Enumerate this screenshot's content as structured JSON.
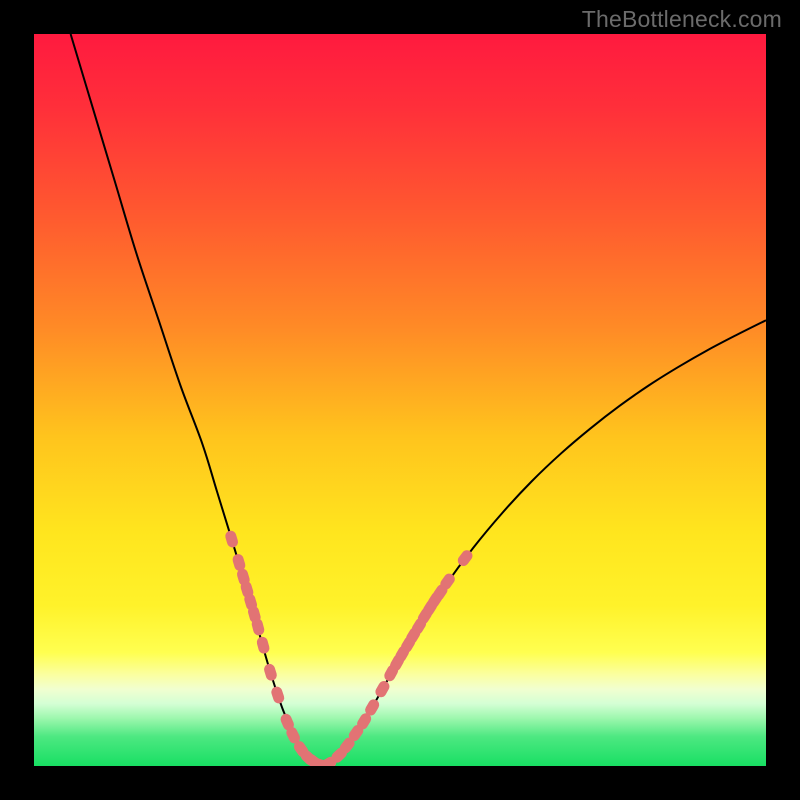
{
  "watermark": "TheBottleneck.com",
  "colors": {
    "frame": "#000000",
    "curve": "#000000",
    "marker": "#e27374",
    "gradient_stops": [
      {
        "offset": 0.0,
        "color": "#ff1a3f"
      },
      {
        "offset": 0.1,
        "color": "#ff2f3a"
      },
      {
        "offset": 0.25,
        "color": "#ff5a2f"
      },
      {
        "offset": 0.4,
        "color": "#ff8a26"
      },
      {
        "offset": 0.55,
        "color": "#ffc41d"
      },
      {
        "offset": 0.68,
        "color": "#ffe51e"
      },
      {
        "offset": 0.78,
        "color": "#fff22a"
      },
      {
        "offset": 0.845,
        "color": "#ffff50"
      },
      {
        "offset": 0.875,
        "color": "#fbffa0"
      },
      {
        "offset": 0.895,
        "color": "#f1ffd0"
      },
      {
        "offset": 0.915,
        "color": "#d4ffd4"
      },
      {
        "offset": 0.935,
        "color": "#9cf7ad"
      },
      {
        "offset": 0.96,
        "color": "#4de881"
      },
      {
        "offset": 1.0,
        "color": "#18df63"
      }
    ]
  },
  "chart_data": {
    "type": "line",
    "title": "",
    "xlabel": "",
    "ylabel": "",
    "xlim": [
      0,
      100
    ],
    "ylim": [
      0,
      100
    ],
    "grid": false,
    "legend": false,
    "series": [
      {
        "name": "bottleneck-curve",
        "x": [
          5,
          8,
          11,
          14,
          17,
          20,
          23,
          25,
          27,
          28.5,
          30,
          31,
          32,
          33,
          34,
          35,
          36,
          37,
          38,
          39,
          40,
          42,
          44,
          46,
          48,
          50,
          53,
          56,
          60,
          64,
          68,
          72,
          76,
          80,
          84,
          88,
          92,
          96,
          100
        ],
        "y": [
          100,
          90,
          80,
          70,
          61,
          52,
          44,
          37.5,
          31,
          26,
          21,
          17.3,
          13.8,
          10.6,
          7.7,
          5.3,
          3.3,
          1.8,
          0.8,
          0.2,
          0.3,
          1.9,
          4.5,
          7.7,
          11.2,
          14.8,
          19.8,
          24.4,
          29.8,
          34.6,
          38.9,
          42.7,
          46.1,
          49.2,
          52.0,
          54.5,
          56.8,
          58.9,
          60.9
        ]
      }
    ],
    "markers": {
      "name": "highlighted-points",
      "points": [
        {
          "x": 27.0,
          "y": 31.0
        },
        {
          "x": 28.0,
          "y": 27.8
        },
        {
          "x": 28.6,
          "y": 25.8
        },
        {
          "x": 29.1,
          "y": 24.1
        },
        {
          "x": 29.6,
          "y": 22.4
        },
        {
          "x": 30.1,
          "y": 20.7
        },
        {
          "x": 30.6,
          "y": 19.0
        },
        {
          "x": 31.3,
          "y": 16.5
        },
        {
          "x": 32.3,
          "y": 12.8
        },
        {
          "x": 33.3,
          "y": 9.7
        },
        {
          "x": 34.6,
          "y": 6.0
        },
        {
          "x": 35.4,
          "y": 4.2
        },
        {
          "x": 36.5,
          "y": 2.3
        },
        {
          "x": 37.5,
          "y": 1.1
        },
        {
          "x": 38.2,
          "y": 0.6
        },
        {
          "x": 39.0,
          "y": 0.2
        },
        {
          "x": 40.2,
          "y": 0.3
        },
        {
          "x": 41.7,
          "y": 1.5
        },
        {
          "x": 42.8,
          "y": 2.8
        },
        {
          "x": 44.0,
          "y": 4.5
        },
        {
          "x": 45.1,
          "y": 6.1
        },
        {
          "x": 46.2,
          "y": 8.0
        },
        {
          "x": 47.6,
          "y": 10.5
        },
        {
          "x": 48.8,
          "y": 12.7
        },
        {
          "x": 49.6,
          "y": 14.1
        },
        {
          "x": 50.3,
          "y": 15.3
        },
        {
          "x": 51.1,
          "y": 16.6
        },
        {
          "x": 51.8,
          "y": 17.8
        },
        {
          "x": 52.6,
          "y": 19.1
        },
        {
          "x": 53.4,
          "y": 20.5
        },
        {
          "x": 54.1,
          "y": 21.6
        },
        {
          "x": 54.8,
          "y": 22.7
        },
        {
          "x": 55.5,
          "y": 23.7
        },
        {
          "x": 56.5,
          "y": 25.2
        },
        {
          "x": 58.9,
          "y": 28.4
        }
      ]
    }
  }
}
